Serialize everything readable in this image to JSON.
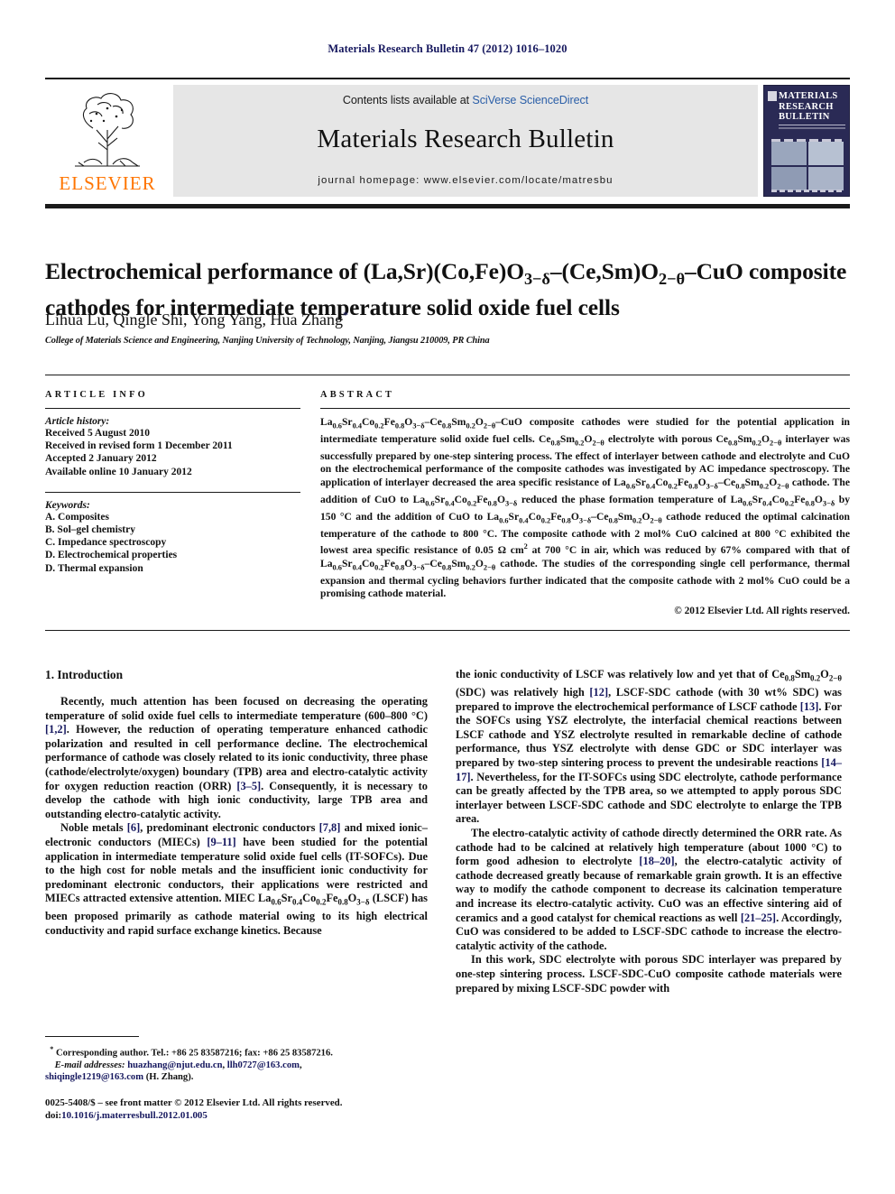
{
  "running_head": "Materials Research Bulletin 47 (2012) 1016–1020",
  "masthead": {
    "contents_prefix": "Contents lists available at ",
    "sciencedirect": "SciVerse ScienceDirect",
    "journal_name": "Materials Research Bulletin",
    "homepage": "journal homepage: www.elsevier.com/locate/matresbu",
    "publisher": "ELSEVIER",
    "cover_title_line1": "MATERIALS",
    "cover_title_line2": "RESEARCH",
    "cover_title_line3": "BULLETIN"
  },
  "article": {
    "title": "Electrochemical performance of (La,Sr)(Co,Fe)O3−δ–(Ce,Sm)O2−θ–CuO composite cathodes for intermediate temperature solid oxide fuel cells",
    "authors": "Lihua Lu, Qingle Shi, Yong Yang, Hua Zhang",
    "affiliation": "College of Materials Science and Engineering, Nanjing University of Technology, Nanjing, Jiangsu 210009, PR China"
  },
  "info": {
    "heading": "ARTICLE INFO",
    "history_label": "Article history:",
    "history": [
      "Received 5 August 2010",
      "Received in revised form 1 December 2011",
      "Accepted 2 January 2012",
      "Available online 10 January 2012"
    ],
    "keywords_label": "Keywords:",
    "keywords": [
      "A. Composites",
      "B. Sol–gel chemistry",
      "C. Impedance spectroscopy",
      "D. Electrochemical properties",
      "D. Thermal expansion"
    ]
  },
  "abstract": {
    "heading": "ABSTRACT",
    "copyright": "© 2012 Elsevier Ltd. All rights reserved."
  },
  "body": {
    "intro_heading": "1. Introduction",
    "footnotes": {
      "corresponding": "Corresponding author. Tel.: +86 25 83587216; fax: +86 25 83587216.",
      "email_label": "E-mail addresses:",
      "email1": "huazhang@njut.edu.cn",
      "email2": "llh0727@163.com",
      "email3": "shiqingle1219@163.com",
      "email_suffix": "(H. Zhang)."
    },
    "imprint": {
      "issn_line": "0025-5408/$ – see front matter © 2012 Elsevier Ltd. All rights reserved.",
      "doi_label": "doi:",
      "doi_value": "10.1016/j.materresbull.2012.01.005"
    }
  },
  "colors": {
    "heading_navy": "#15175e",
    "link_blue": "#2b5fa8",
    "elsevier_orange": "#ff7500",
    "cover_navy": "#2a2a55"
  }
}
